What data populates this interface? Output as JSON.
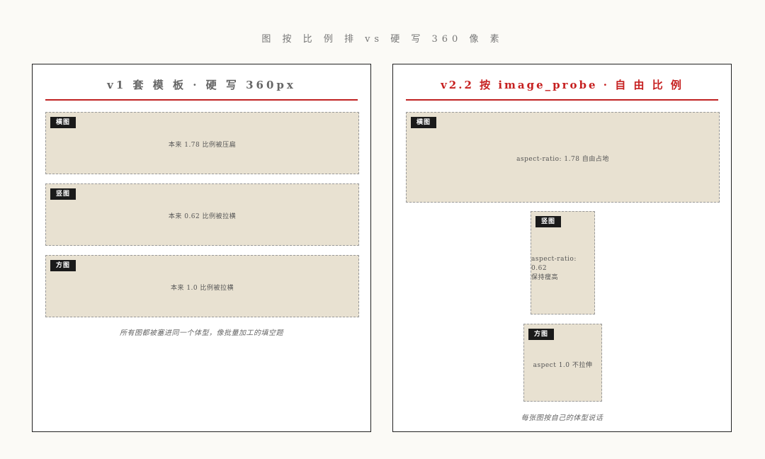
{
  "page": {
    "title": "图 按 比 例 排 vs 硬 写 360 像 素"
  },
  "left_panel": {
    "title": "v1 套 模 板 · 硬 写 360px",
    "boxes": [
      {
        "tag": "横图",
        "text": "本来 1.78 比例被压扁"
      },
      {
        "tag": "竖图",
        "text": "本来 0.62 比例被拉横"
      },
      {
        "tag": "方图",
        "text": "本来 1.0 比例被拉横"
      }
    ],
    "caption": "所有图都被塞进同一个体型，像批量加工的填空题"
  },
  "right_panel": {
    "title": "v2.2 按 image_probe · 自 由 比 例",
    "boxes": [
      {
        "tag": "横图",
        "text": "aspect-ratio: 1.78 自由占地"
      },
      {
        "tag": "竖图",
        "text_line1": "aspect-ratio: 0.62",
        "text_line2": "保持瘦高"
      },
      {
        "tag": "方图",
        "text": "aspect 1.0 不拉伸"
      }
    ],
    "caption": "每张图按自己的体型说话"
  },
  "colors": {
    "accent": "#c02222",
    "box_fill": "#e8e1d1",
    "tag_bg": "#1a1a1a",
    "background": "#fbfaf6"
  }
}
